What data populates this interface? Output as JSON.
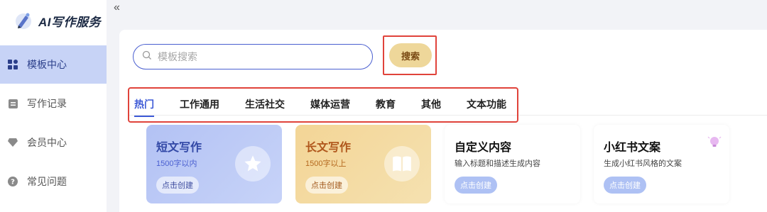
{
  "app": {
    "name": "AI写作服务"
  },
  "sidebar": {
    "items": [
      {
        "label": "模板中心",
        "icon": "grid-icon",
        "active": true
      },
      {
        "label": "写作记录",
        "icon": "document-icon",
        "active": false
      },
      {
        "label": "会员中心",
        "icon": "diamond-icon",
        "active": false
      },
      {
        "label": "常见问题",
        "icon": "question-icon",
        "active": false
      }
    ]
  },
  "toolbar": {
    "collapse_glyph": "«"
  },
  "search": {
    "placeholder": "模板搜索",
    "button_label": "搜索"
  },
  "tabs": [
    {
      "label": "热门",
      "active": true
    },
    {
      "label": "工作通用",
      "active": false
    },
    {
      "label": "生活社交",
      "active": false
    },
    {
      "label": "媒体运营",
      "active": false
    },
    {
      "label": "教育",
      "active": false
    },
    {
      "label": "其他",
      "active": false
    },
    {
      "label": "文本功能",
      "active": false
    }
  ],
  "cards": [
    {
      "title": "短文写作",
      "subtitle": "1500字以内",
      "button": "点击创建",
      "icon": "star-icon",
      "theme": "blue"
    },
    {
      "title": "长文写作",
      "subtitle": "1500字以上",
      "button": "点击创建",
      "icon": "book-icon",
      "theme": "gold"
    },
    {
      "title": "自定义内容",
      "subtitle": "输入标题和描述生成内容",
      "button": "点击创建",
      "icon": "",
      "theme": "white"
    },
    {
      "title": "小红书文案",
      "subtitle": "生成小红书风格的文案",
      "button": "点击创建",
      "icon": "lightbulb-icon",
      "theme": "white"
    }
  ],
  "colors": {
    "accent": "#3c59d6",
    "search_button": "#eed79a",
    "highlight_frame": "#e0433b",
    "sidebar_active": "#c7d3f6"
  }
}
